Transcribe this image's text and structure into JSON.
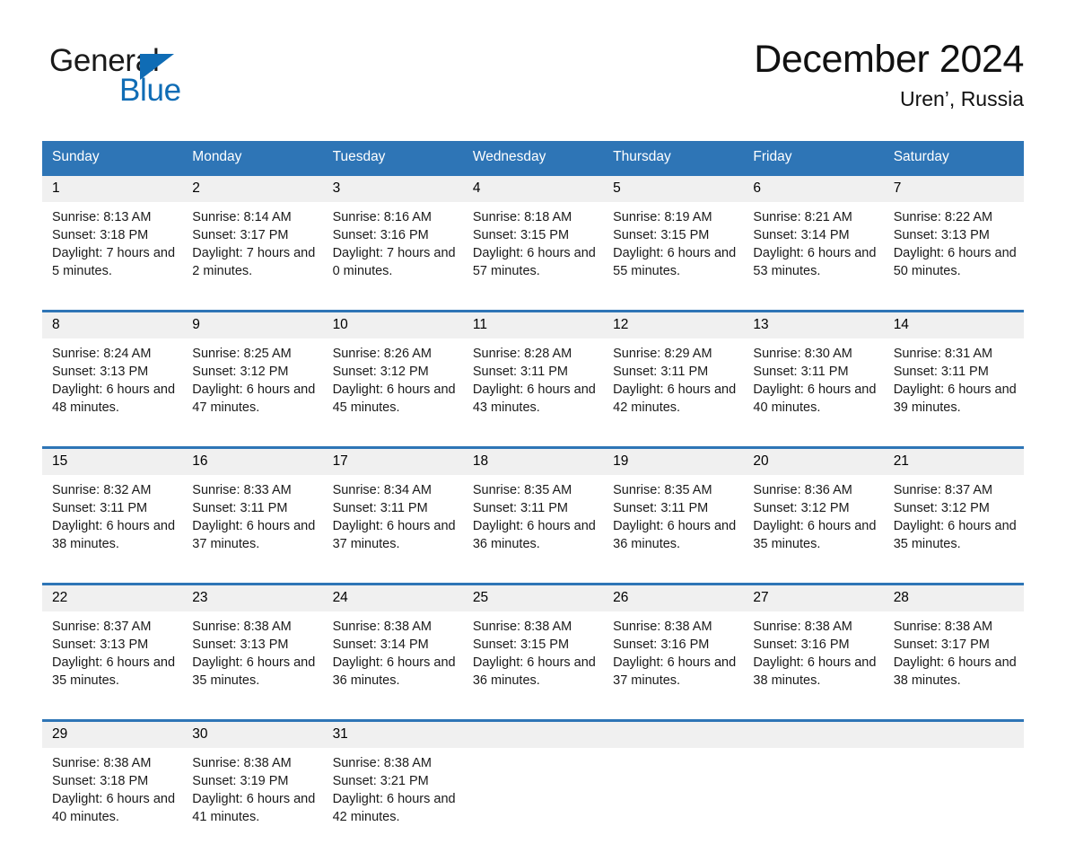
{
  "brand": {
    "name_part1": "General",
    "name_part2": "Blue",
    "logo_icon": "triangle-icon",
    "accent_color": "#0f6cb5"
  },
  "header": {
    "month_title": "December 2024",
    "location": "Uren’, Russia"
  },
  "theme": {
    "header_blue": "#2e75b6",
    "daynum_band": "#f0f0f0",
    "text": "#1a1a1a"
  },
  "calendar": {
    "weekday_headers": [
      "Sunday",
      "Monday",
      "Tuesday",
      "Wednesday",
      "Thursday",
      "Friday",
      "Saturday"
    ],
    "weeks": [
      {
        "days": [
          {
            "date": "1",
            "sunrise": "Sunrise: 8:13 AM",
            "sunset": "Sunset: 3:18 PM",
            "daylight": "Daylight: 7 hours and 5 minutes."
          },
          {
            "date": "2",
            "sunrise": "Sunrise: 8:14 AM",
            "sunset": "Sunset: 3:17 PM",
            "daylight": "Daylight: 7 hours and 2 minutes."
          },
          {
            "date": "3",
            "sunrise": "Sunrise: 8:16 AM",
            "sunset": "Sunset: 3:16 PM",
            "daylight": "Daylight: 7 hours and 0 minutes."
          },
          {
            "date": "4",
            "sunrise": "Sunrise: 8:18 AM",
            "sunset": "Sunset: 3:15 PM",
            "daylight": "Daylight: 6 hours and 57 minutes."
          },
          {
            "date": "5",
            "sunrise": "Sunrise: 8:19 AM",
            "sunset": "Sunset: 3:15 PM",
            "daylight": "Daylight: 6 hours and 55 minutes."
          },
          {
            "date": "6",
            "sunrise": "Sunrise: 8:21 AM",
            "sunset": "Sunset: 3:14 PM",
            "daylight": "Daylight: 6 hours and 53 minutes."
          },
          {
            "date": "7",
            "sunrise": "Sunrise: 8:22 AM",
            "sunset": "Sunset: 3:13 PM",
            "daylight": "Daylight: 6 hours and 50 minutes."
          }
        ]
      },
      {
        "days": [
          {
            "date": "8",
            "sunrise": "Sunrise: 8:24 AM",
            "sunset": "Sunset: 3:13 PM",
            "daylight": "Daylight: 6 hours and 48 minutes."
          },
          {
            "date": "9",
            "sunrise": "Sunrise: 8:25 AM",
            "sunset": "Sunset: 3:12 PM",
            "daylight": "Daylight: 6 hours and 47 minutes."
          },
          {
            "date": "10",
            "sunrise": "Sunrise: 8:26 AM",
            "sunset": "Sunset: 3:12 PM",
            "daylight": "Daylight: 6 hours and 45 minutes."
          },
          {
            "date": "11",
            "sunrise": "Sunrise: 8:28 AM",
            "sunset": "Sunset: 3:11 PM",
            "daylight": "Daylight: 6 hours and 43 minutes."
          },
          {
            "date": "12",
            "sunrise": "Sunrise: 8:29 AM",
            "sunset": "Sunset: 3:11 PM",
            "daylight": "Daylight: 6 hours and 42 minutes."
          },
          {
            "date": "13",
            "sunrise": "Sunrise: 8:30 AM",
            "sunset": "Sunset: 3:11 PM",
            "daylight": "Daylight: 6 hours and 40 minutes."
          },
          {
            "date": "14",
            "sunrise": "Sunrise: 8:31 AM",
            "sunset": "Sunset: 3:11 PM",
            "daylight": "Daylight: 6 hours and 39 minutes."
          }
        ]
      },
      {
        "days": [
          {
            "date": "15",
            "sunrise": "Sunrise: 8:32 AM",
            "sunset": "Sunset: 3:11 PM",
            "daylight": "Daylight: 6 hours and 38 minutes."
          },
          {
            "date": "16",
            "sunrise": "Sunrise: 8:33 AM",
            "sunset": "Sunset: 3:11 PM",
            "daylight": "Daylight: 6 hours and 37 minutes."
          },
          {
            "date": "17",
            "sunrise": "Sunrise: 8:34 AM",
            "sunset": "Sunset: 3:11 PM",
            "daylight": "Daylight: 6 hours and 37 minutes."
          },
          {
            "date": "18",
            "sunrise": "Sunrise: 8:35 AM",
            "sunset": "Sunset: 3:11 PM",
            "daylight": "Daylight: 6 hours and 36 minutes."
          },
          {
            "date": "19",
            "sunrise": "Sunrise: 8:35 AM",
            "sunset": "Sunset: 3:11 PM",
            "daylight": "Daylight: 6 hours and 36 minutes."
          },
          {
            "date": "20",
            "sunrise": "Sunrise: 8:36 AM",
            "sunset": "Sunset: 3:12 PM",
            "daylight": "Daylight: 6 hours and 35 minutes."
          },
          {
            "date": "21",
            "sunrise": "Sunrise: 8:37 AM",
            "sunset": "Sunset: 3:12 PM",
            "daylight": "Daylight: 6 hours and 35 minutes."
          }
        ]
      },
      {
        "days": [
          {
            "date": "22",
            "sunrise": "Sunrise: 8:37 AM",
            "sunset": "Sunset: 3:13 PM",
            "daylight": "Daylight: 6 hours and 35 minutes."
          },
          {
            "date": "23",
            "sunrise": "Sunrise: 8:38 AM",
            "sunset": "Sunset: 3:13 PM",
            "daylight": "Daylight: 6 hours and 35 minutes."
          },
          {
            "date": "24",
            "sunrise": "Sunrise: 8:38 AM",
            "sunset": "Sunset: 3:14 PM",
            "daylight": "Daylight: 6 hours and 36 minutes."
          },
          {
            "date": "25",
            "sunrise": "Sunrise: 8:38 AM",
            "sunset": "Sunset: 3:15 PM",
            "daylight": "Daylight: 6 hours and 36 minutes."
          },
          {
            "date": "26",
            "sunrise": "Sunrise: 8:38 AM",
            "sunset": "Sunset: 3:16 PM",
            "daylight": "Daylight: 6 hours and 37 minutes."
          },
          {
            "date": "27",
            "sunrise": "Sunrise: 8:38 AM",
            "sunset": "Sunset: 3:16 PM",
            "daylight": "Daylight: 6 hours and 38 minutes."
          },
          {
            "date": "28",
            "sunrise": "Sunrise: 8:38 AM",
            "sunset": "Sunset: 3:17 PM",
            "daylight": "Daylight: 6 hours and 38 minutes."
          }
        ]
      },
      {
        "days": [
          {
            "date": "29",
            "sunrise": "Sunrise: 8:38 AM",
            "sunset": "Sunset: 3:18 PM",
            "daylight": "Daylight: 6 hours and 40 minutes."
          },
          {
            "date": "30",
            "sunrise": "Sunrise: 8:38 AM",
            "sunset": "Sunset: 3:19 PM",
            "daylight": "Daylight: 6 hours and 41 minutes."
          },
          {
            "date": "31",
            "sunrise": "Sunrise: 8:38 AM",
            "sunset": "Sunset: 3:21 PM",
            "daylight": "Daylight: 6 hours and 42 minutes."
          },
          {
            "date": "",
            "sunrise": "",
            "sunset": "",
            "daylight": ""
          },
          {
            "date": "",
            "sunrise": "",
            "sunset": "",
            "daylight": ""
          },
          {
            "date": "",
            "sunrise": "",
            "sunset": "",
            "daylight": ""
          },
          {
            "date": "",
            "sunrise": "",
            "sunset": "",
            "daylight": ""
          }
        ]
      }
    ]
  }
}
